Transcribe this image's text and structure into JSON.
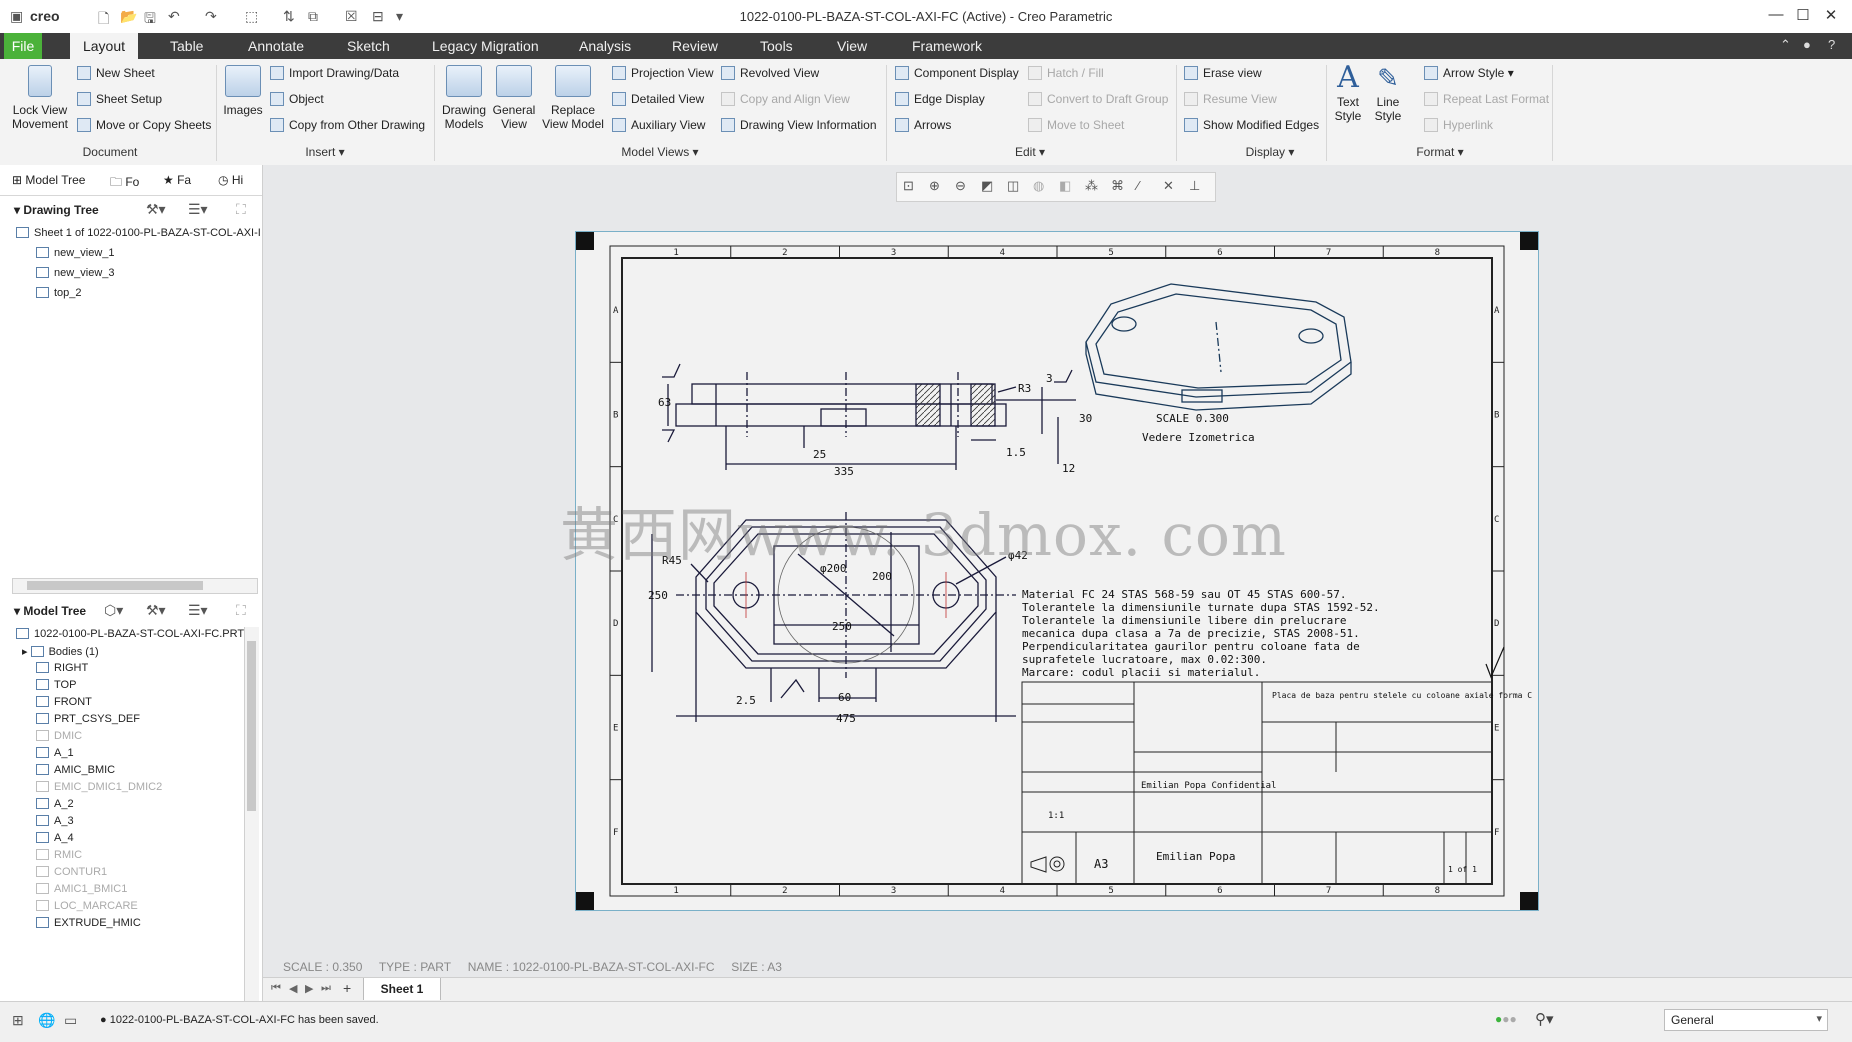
{
  "app": {
    "logo": "creo",
    "window_title": "1022-0100-PL-BAZA-ST-COL-AXI-FC (Active) - Creo Parametric",
    "window_controls": [
      "—",
      "☐",
      "✕"
    ]
  },
  "menu": {
    "tabs": [
      "File",
      "Layout",
      "Table",
      "Annotate",
      "Sketch",
      "Legacy Migration",
      "Analysis",
      "Review",
      "Tools",
      "View",
      "Framework"
    ],
    "active": "Layout",
    "colors": {
      "file_tab": "#4bb23a",
      "menubar": "#3c3c3c"
    }
  },
  "ribbon": {
    "document": {
      "lock_view_movement": "Lock View Movement",
      "new_sheet": "New Sheet",
      "sheet_setup": "Sheet Setup",
      "move_copy_sheets": "Move or Copy Sheets",
      "label": "Document"
    },
    "insert": {
      "images": "Images",
      "import": "Import Drawing/Data",
      "object": "Object",
      "copy_from_other": "Copy from Other Drawing",
      "label": "Insert"
    },
    "model_views": {
      "drawing_models": "Drawing Models",
      "general_view": "General View",
      "replace_view_model": "Replace View Model",
      "projection_view": "Projection View",
      "detailed_view": "Detailed View",
      "auxiliary_view": "Auxiliary View",
      "revolved_view": "Revolved View",
      "copy_align_view": "Copy and Align View",
      "drawing_view_info": "Drawing View Information",
      "label": "Model Views"
    },
    "edit": {
      "component_display": "Component Display",
      "edge_display": "Edge Display",
      "arrows": "Arrows",
      "hatch_fill": "Hatch / Fill",
      "convert_draft_group": "Convert to Draft Group",
      "move_to_sheet": "Move to Sheet",
      "label": "Edit"
    },
    "display": {
      "erase_view": "Erase view",
      "resume_view": "Resume View",
      "show_modified_edges": "Show Modified Edges",
      "label": "Display"
    },
    "format": {
      "text_style": "Text Style",
      "line_style": "Line Style",
      "arrow_style": "Arrow Style",
      "repeat_last_format": "Repeat Last Format",
      "hyperlink": "Hyperlink",
      "label": "Format"
    }
  },
  "left_panel": {
    "tabs": [
      "Model Tree",
      "Fo",
      "Fa",
      "Hi"
    ],
    "drawing_tree": {
      "title": "Drawing Tree",
      "items": [
        "Sheet 1 of 1022-0100-PL-BAZA-ST-COL-AXI-I",
        "new_view_1",
        "new_view_3",
        "top_2"
      ]
    },
    "model_tree": {
      "title": "Model Tree",
      "items": [
        {
          "label": "1022-0100-PL-BAZA-ST-COL-AXI-FC.PRT",
          "dim": false
        },
        {
          "label": "Bodies (1)",
          "dim": false
        },
        {
          "label": "RIGHT",
          "dim": false
        },
        {
          "label": "TOP",
          "dim": false
        },
        {
          "label": "FRONT",
          "dim": false
        },
        {
          "label": "PRT_CSYS_DEF",
          "dim": false
        },
        {
          "label": "DMIC",
          "dim": true
        },
        {
          "label": "A_1",
          "dim": false
        },
        {
          "label": "AMIC_BMIC",
          "dim": false
        },
        {
          "label": "EMIC_DMIC1_DMIC2",
          "dim": true
        },
        {
          "label": "A_2",
          "dim": false
        },
        {
          "label": "A_3",
          "dim": false
        },
        {
          "label": "A_4",
          "dim": false
        },
        {
          "label": "RMIC",
          "dim": true
        },
        {
          "label": "CONTUR1",
          "dim": true
        },
        {
          "label": "AMIC1_BMIC1",
          "dim": true
        },
        {
          "label": "LOC_MARCARE",
          "dim": true
        },
        {
          "label": "EXTRUDE_HMIC",
          "dim": false
        }
      ]
    }
  },
  "drawing": {
    "border_numbers": [
      "1",
      "2",
      "3",
      "4",
      "5",
      "6",
      "7",
      "8"
    ],
    "border_letters": [
      "A",
      "B",
      "C",
      "D",
      "E",
      "F"
    ],
    "dims_top": {
      "h63": "63",
      "d25": "25",
      "d335": "335",
      "r3": "R3",
      "d3": "3",
      "d30": "30",
      "d15": "1.5",
      "d12": "12"
    },
    "dims_plan": {
      "r45": "R45",
      "d250": "250",
      "phi200": "φ200",
      "d200": "200",
      "d250h": "250",
      "phi42": "φ42",
      "d25": "2.5",
      "d60": "60",
      "d475": "475"
    },
    "iso_scale": "SCALE 0.300",
    "iso_label": "Vedere Izometrica",
    "notes": [
      "Material FC 24 STAS 568-59 sau OT 45 STAS 600-57.",
      "Tolerantele la dimensiunile turnate dupa STAS 1592-52.",
      "Tolerantele la dimensiunile libere din prelucrare",
      "mecanica dupa clasa a 7a de precizie, STAS 2008-51.",
      "Perpendicularitatea gaurilor pentru coloane fata de",
      "suprafetele lucratoare, max 0.02:300.",
      "Marcare: codul placii si materialul."
    ],
    "title_block": {
      "description": "Placa de baza pentru stelele cu coloane axiale forma C",
      "company": "Emilian Popa Confidential",
      "designer": "Emilian Popa",
      "sheet_size": "A3",
      "scale": "1:1",
      "sheet": "1 of 1"
    }
  },
  "canvas_info": {
    "scale": "SCALE : 0.350",
    "type": "TYPE : PART",
    "name": "NAME : 1022-0100-PL-BAZA-ST-COL-AXI-FC",
    "size": "SIZE : A3"
  },
  "watermark": "黄西网www. 3dmox. com",
  "sheet_tabs": {
    "current": "Sheet 1"
  },
  "status": {
    "message": "1022-0100-PL-BAZA-ST-COL-AXI-FC has been saved.",
    "filter": "General"
  }
}
